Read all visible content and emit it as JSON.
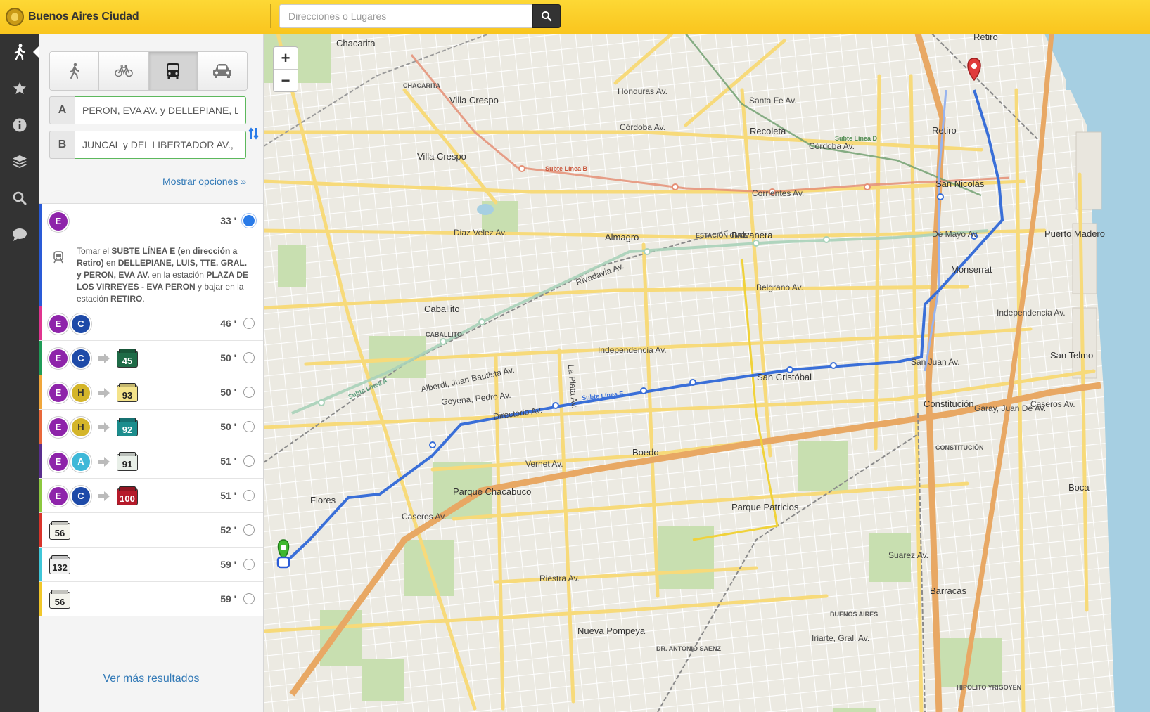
{
  "header": {
    "brand": "Buenos Aires Ciudad",
    "search_placeholder": "Direcciones o Lugares"
  },
  "sidebar": {
    "items": [
      {
        "name": "walk",
        "icon": "walking-person-icon"
      },
      {
        "name": "favorites",
        "icon": "star-icon"
      },
      {
        "name": "info",
        "icon": "info-icon"
      },
      {
        "name": "layers",
        "icon": "layers-icon"
      },
      {
        "name": "search",
        "icon": "search-icon"
      },
      {
        "name": "feedback",
        "icon": "chat-bubble-icon"
      }
    ]
  },
  "modes": [
    "walk",
    "bike",
    "transit",
    "car"
  ],
  "active_mode": "transit",
  "route": {
    "a_letter": "A",
    "a_value": "PERON, EVA AV. y DELLEPIANE, LUIS",
    "b_letter": "B",
    "b_value": "JUNCAL y DEL LIBERTADOR AV.,",
    "more_options": "Mostrar opciones »"
  },
  "colors": {
    "line_E": "#8e24aa",
    "line_C": "#1e4aa8",
    "line_H": "#d4b52a",
    "line_A": "#3fb8d8",
    "route_blue": "#3a6fd8"
  },
  "results": [
    {
      "stripe": "#2a5bd7",
      "chips": [
        "E"
      ],
      "buses": [],
      "mins": "33 '",
      "selected": true
    },
    {
      "stripe": "#e0348f",
      "chips": [
        "E",
        "C"
      ],
      "buses": [],
      "mins": "46 '",
      "selected": false
    },
    {
      "stripe": "#1f9b57",
      "chips": [
        "E",
        "C"
      ],
      "buses": [
        {
          "num": "45",
          "bg": "#1e6b47",
          "fg": "#fff"
        }
      ],
      "mins": "50 '",
      "selected": false
    },
    {
      "stripe": "#f0a63b",
      "chips": [
        "E",
        "H"
      ],
      "buses": [
        {
          "num": "93",
          "bg": "#f4e38a",
          "fg": "#222"
        }
      ],
      "mins": "50 '",
      "selected": false
    },
    {
      "stripe": "#e8683a",
      "chips": [
        "E",
        "H"
      ],
      "buses": [
        {
          "num": "92",
          "bg": "#1c8d8d",
          "fg": "#fff"
        }
      ],
      "mins": "50 '",
      "selected": false
    },
    {
      "stripe": "#5a2e8e",
      "chips": [
        "E",
        "A"
      ],
      "buses": [
        {
          "num": "91",
          "bg": "#e8efe8",
          "fg": "#222"
        }
      ],
      "mins": "51 '",
      "selected": false
    },
    {
      "stripe": "#8cc83f",
      "chips": [
        "E",
        "C"
      ],
      "buses": [
        {
          "num": "100",
          "bg": "#b51a2a",
          "fg": "#fff"
        }
      ],
      "mins": "51 '",
      "selected": false
    },
    {
      "stripe": "#d9342b",
      "chips": [],
      "buses": [
        {
          "num": "56",
          "bg": "#f4f4ec",
          "fg": "#222"
        }
      ],
      "mins": "52 '",
      "selected": false
    },
    {
      "stripe": "#3fc6d8",
      "chips": [],
      "buses": [
        {
          "num": "132",
          "bg": "#f1f1f1",
          "fg": "#222"
        }
      ],
      "mins": "59 '",
      "selected": false
    },
    {
      "stripe": "#f1c72a",
      "chips": [],
      "buses": [
        {
          "num": "56",
          "bg": "#f4f4ec",
          "fg": "#222"
        }
      ],
      "mins": "59 '",
      "selected": false
    }
  ],
  "detail": {
    "t1": "Tomar el ",
    "t2": "SUBTE LÍNEA E (en dirección a Retiro)",
    "t3": " en ",
    "t4": "DELLEPIANE, LUIS, TTE. GRAL. y PERON, EVA AV.",
    "t5": " en la estación ",
    "t6": "PLAZA DE LOS VIRREYES - EVA PERON",
    "t7": " y bajar en la estación ",
    "t8": "RETIRO",
    "t9": "."
  },
  "see_more": "Ver más resultados",
  "map": {
    "zoom_in": "+",
    "zoom_out": "−",
    "labels": {
      "chacarita": "Chacarita",
      "villa_crespo_1": "Villa Crespo",
      "villa_crespo_2": "Villa Crespo",
      "recoleta": "Recoleta",
      "retiro_top": "Retiro",
      "retiro": "Retiro",
      "san_nicolas": "San Nicolás",
      "puerto_madero": "Puerto Madero",
      "almagro": "Almagro",
      "balvanera": "Balvanera",
      "monserrat": "Monserrat",
      "caballito": "Caballito",
      "san_telmo": "San Telmo",
      "san_cristobal": "San Cristóbal",
      "constitucion": "Constitución",
      "boedo": "Boedo",
      "boca": "Boca",
      "parque_chacabuco": "Parque Chacabuco",
      "flores": "Flores",
      "parque_patricios": "Parque Patricios",
      "barracas": "Barracas",
      "nueva_pompeya": "Nueva Pompeya",
      "cordoba_av": "Córdoba Av.",
      "corrientes_av": "Corrientes Av.",
      "rivadavia_av": "Rivadavia Av.",
      "belgrano_av": "Belgrano Av.",
      "independencia_av": "Independencia Av.",
      "directorio_av": "Directorio Av.",
      "caseros_av": "Caseros Av.",
      "santa_fe_av": "Santa Fe Av.",
      "de_mayo_av": "De Mayo Av.",
      "san_juan_av": "San Juan Av.",
      "vernet_av": "Vernet Av.",
      "riestra_av": "Riestra Av.",
      "honduras_av": "Honduras Av.",
      "diaz_velez_av": "Diaz Velez Av.",
      "goyena_pedro_av": "Goyena, Pedro Av.",
      "alberdi_av": "Alberdi, Juan Bautista Av.",
      "garay_av": "Garay, Juan De Av.",
      "suarez_av": "Suarez Av.",
      "iriarte_av": "Iriarte, Gral. Av.",
      "la_plata_av": "La Plata Av.",
      "subte_b": "Subte Línea B",
      "subte_e": "Subte Línea E",
      "subte_a": "Subte Línea A",
      "subte_d": "Subte Línea D",
      "estacion_once": "ESTACIÓN ONCE",
      "caballito_st": "CABALLITO",
      "constitucion_st": "CONSTITUCIÓN",
      "buenos_aires_st": "BUENOS AIRES",
      "saenz_st": "DR. ANTONIO SAENZ",
      "hipolito_st": "HIPOLITO YRIGOYEN",
      "chacarita_st": "CHACARITA"
    }
  }
}
